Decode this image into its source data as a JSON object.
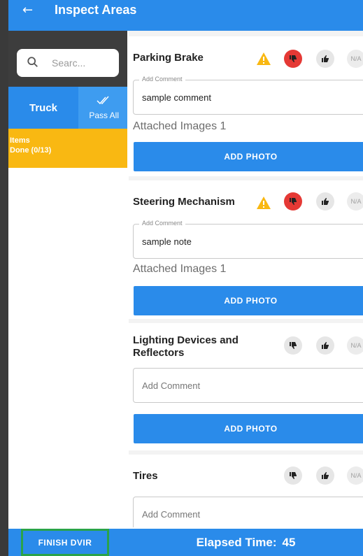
{
  "appbar": {
    "title": "Inspect Areas",
    "back_icon": "arrow-left-icon",
    "back_glyph": "←"
  },
  "sidebar": {
    "search_placeholder": "Searc...",
    "tab_truck": "Truck",
    "tab_pass_all": "Pass All",
    "items_label": "Items",
    "items_done": "Done (0/13)"
  },
  "cards": [
    {
      "title": "Parking Brake",
      "warning": true,
      "selected": "fail",
      "comment_label": "Add Comment",
      "comment": "sample comment",
      "attached": "Attached Images 1",
      "add_photo": "ADD PHOTO",
      "na": "N/A"
    },
    {
      "title": "Steering Mechanism",
      "warning": true,
      "selected": "fail",
      "comment_label": "Add Comment",
      "comment": "sample note",
      "attached": "Attached Images 1",
      "add_photo": "ADD PHOTO",
      "na": "N/A"
    },
    {
      "title_line1": "Lighting Devices and",
      "title_line2": "Reflectors",
      "warning": false,
      "selected": "none",
      "comment_placeholder": "Add Comment",
      "add_photo": "ADD PHOTO",
      "na": "N/A"
    },
    {
      "title": "Tires",
      "warning": false,
      "selected": "none",
      "comment_placeholder": "Add Comment",
      "na": "N/A"
    }
  ],
  "bottom": {
    "finish_label": "FINISH DVIR",
    "elapsed_label": "Elapsed Time:",
    "elapsed_value": "45"
  },
  "colors": {
    "primary": "#2a8bea",
    "fail": "#e53935",
    "warning": "#f9b812",
    "highlight": "#2aa34a"
  }
}
